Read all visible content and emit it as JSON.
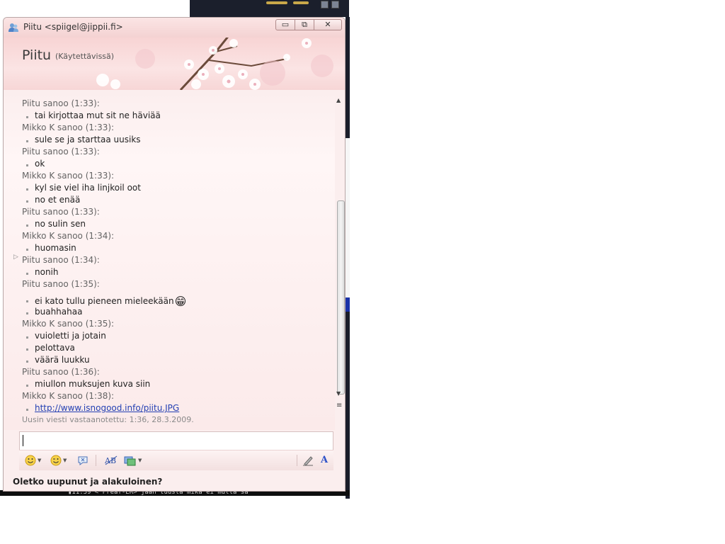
{
  "window": {
    "title": "Piitu <spiigel@jippii.fi>",
    "controls": {
      "minimize": "▭",
      "maximize": "⧉",
      "close": "✕"
    }
  },
  "header": {
    "contact_name": "Piitu",
    "contact_status": "(Käytettävissä)"
  },
  "conversation": {
    "lines": [
      {
        "kind": "sender",
        "text": "Piitu sanoo (1:33):"
      },
      {
        "kind": "item",
        "text": "tai kirjottaa mut sit ne häviää"
      },
      {
        "kind": "sender",
        "text": "Mikko K sanoo (1:33):"
      },
      {
        "kind": "item",
        "text": "sule se ja starttaa uusiks"
      },
      {
        "kind": "sender",
        "text": "Piitu sanoo (1:33):"
      },
      {
        "kind": "item",
        "text": "ok"
      },
      {
        "kind": "sender",
        "text": "Mikko K sanoo (1:33):"
      },
      {
        "kind": "item",
        "text": "kyl sie viel iha linjkoil oot"
      },
      {
        "kind": "item",
        "text": "no et enää"
      },
      {
        "kind": "sender",
        "text": "Piitu sanoo (1:33):"
      },
      {
        "kind": "item",
        "text": "no sulin sen"
      },
      {
        "kind": "sender",
        "text": "Mikko K sanoo (1:34):"
      },
      {
        "kind": "item",
        "text": "huomasin"
      },
      {
        "kind": "sender",
        "text": "Piitu sanoo (1:34):"
      },
      {
        "kind": "item",
        "text": "nonih"
      },
      {
        "kind": "sender",
        "text": "Piitu sanoo (1:35):"
      },
      {
        "kind": "item",
        "text": "ei kato tullu pieneen mieleekään",
        "emoticon": "😁"
      },
      {
        "kind": "item",
        "text": "buahhahaa"
      },
      {
        "kind": "sender",
        "text": "Mikko K sanoo (1:35):"
      },
      {
        "kind": "item",
        "text": "vuioletti ja jotain"
      },
      {
        "kind": "item",
        "text": "pelottava"
      },
      {
        "kind": "item",
        "text": "väärä luukku"
      },
      {
        "kind": "sender",
        "text": "Piitu sanoo (1:36):"
      },
      {
        "kind": "item",
        "text": "miullon muksujen kuva siin"
      },
      {
        "kind": "sender",
        "text": "Mikko K sanoo (1:38):"
      },
      {
        "kind": "link",
        "text": "http://www.isnogood.info/piitu.JPG"
      }
    ],
    "last_received": "Uusin viesti vastaanotettu: 1:36, 28.3.2009."
  },
  "toolbar": {
    "emoticon_icon": "smiley-icon",
    "wink_icon": "wink-icon",
    "nudge_icon": "nudge-icon",
    "spellcheck_icon": "spellcheck-icon",
    "background_icon": "background-icon",
    "handwriting_icon": "handwriting-icon",
    "font_label": "A"
  },
  "footer": {
    "text": "Oletko uupunut ja alakuloinen?"
  },
  "background": {
    "terminal_text": "▮11:39 < Preaf-ER> jaan tuusta mika ei mulla sa"
  },
  "colors": {
    "window_bg": "#fbeeee",
    "link": "#2440b3",
    "sender": "#646464"
  }
}
